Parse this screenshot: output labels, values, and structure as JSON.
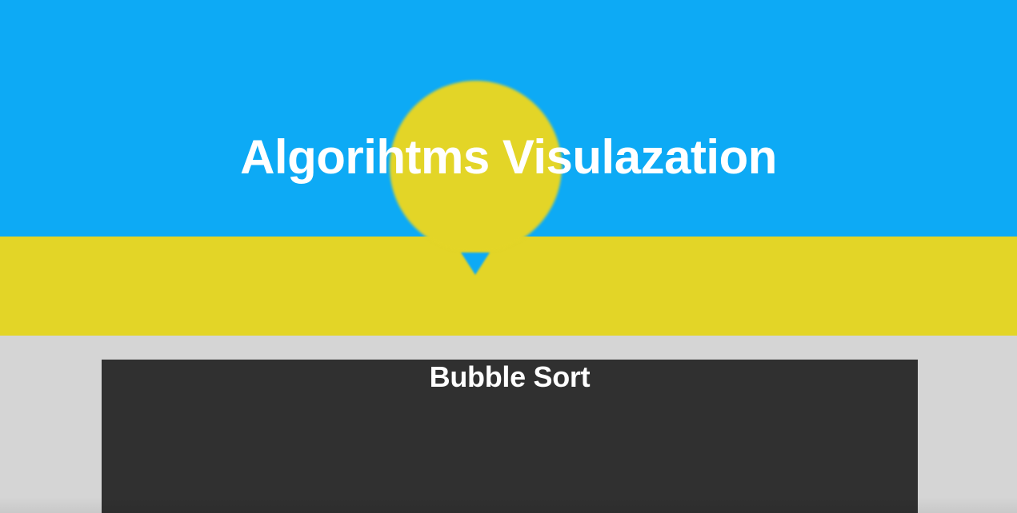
{
  "hero": {
    "title": "Algorihtms Visulazation",
    "sky_color": "#0daaf5",
    "ground_color": "#e3d527",
    "balloon_color": "#e3d527"
  },
  "section": {
    "title": "Bubble Sort",
    "background_color": "#303030"
  },
  "page": {
    "background_color": "#d5d5d5"
  }
}
